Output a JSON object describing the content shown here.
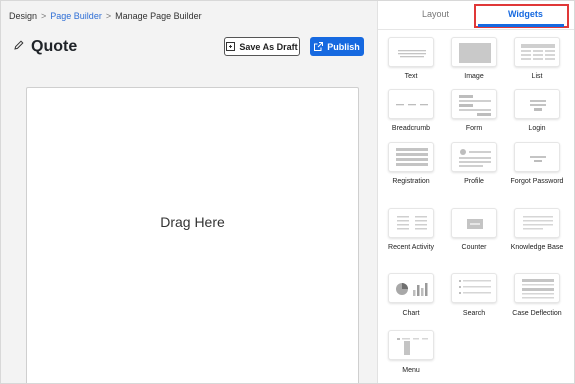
{
  "breadcrumb": {
    "root": "Design",
    "separator": ">",
    "parent": "Page Builder",
    "current": "Manage Page Builder"
  },
  "page": {
    "title": "Quote"
  },
  "actions": {
    "draft_label": "Save As Draft",
    "publish_label": "Publish"
  },
  "canvas": {
    "placeholder": "Drag Here"
  },
  "panel": {
    "tabs": [
      {
        "label": "Layout",
        "active": false
      },
      {
        "label": "Widgets",
        "active": true
      }
    ],
    "widgets": [
      {
        "label": "Text",
        "icon": "text-widget-icon"
      },
      {
        "label": "Image",
        "icon": "image-widget-icon"
      },
      {
        "label": "List",
        "icon": "list-widget-icon"
      },
      {
        "label": "Breadcrumb",
        "icon": "breadcrumb-widget-icon"
      },
      {
        "label": "Form",
        "icon": "form-widget-icon"
      },
      {
        "label": "Login",
        "icon": "login-widget-icon"
      },
      {
        "label": "Registration",
        "icon": "registration-widget-icon"
      },
      {
        "label": "Profile",
        "icon": "profile-widget-icon"
      },
      {
        "label": "Forgot Password",
        "icon": "forgot-password-widget-icon"
      },
      {
        "label": "Recent Activity",
        "icon": "recent-activity-widget-icon"
      },
      {
        "label": "Counter",
        "icon": "counter-widget-icon"
      },
      {
        "label": "Knowledge Base",
        "icon": "knowledge-base-widget-icon"
      },
      {
        "label": "Chart",
        "icon": "chart-widget-icon"
      },
      {
        "label": "Search",
        "icon": "search-widget-icon"
      },
      {
        "label": "Case Deflection",
        "icon": "case-deflection-widget-icon"
      },
      {
        "label": "Menu",
        "icon": "menu-widget-icon"
      }
    ]
  },
  "colors": {
    "accent": "#1669e0",
    "highlight": "#e03838",
    "workspace": "#f3f3f3"
  }
}
